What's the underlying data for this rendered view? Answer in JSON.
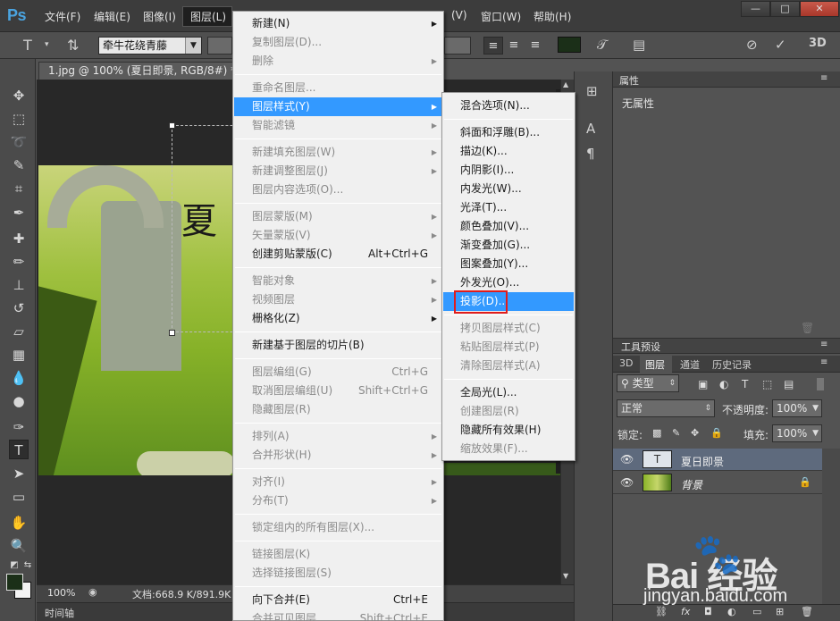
{
  "app": {
    "logo": "Ps",
    "menus": [
      "文件(F)",
      "编辑(E)",
      "图像(I)",
      "图层(L)",
      "(V)",
      "窗口(W)",
      "帮助(H)"
    ],
    "window_buttons": [
      "—",
      "□",
      "✕"
    ]
  },
  "options_bar": {
    "font_family": "牵牛花绕青藤",
    "align_buttons": [
      "≡",
      "≡",
      "≡"
    ],
    "text_color": "#1b2f18"
  },
  "document": {
    "tab_title": "1.jpg @ 100% (夏日即景, RGB/8#) *",
    "tab_close": "×",
    "canvas_text": "夏",
    "zoom": "100%",
    "doc_info": "文档:668.9 K/891.9K",
    "timeline_label": "时间轴"
  },
  "properties_panel": {
    "title": "属性",
    "content": "无属性"
  },
  "presets_panel": {
    "title": "工具预设"
  },
  "layers_panel": {
    "tabs": [
      "3D",
      "图层",
      "通道",
      "历史记录"
    ],
    "filter_kind": "类型",
    "blend_mode": "正常",
    "opacity_label": "不透明度:",
    "opacity_value": "100%",
    "lock_label": "锁定:",
    "fill_label": "填充:",
    "fill_value": "100%",
    "layers": [
      {
        "name": "夏日即景",
        "type": "text",
        "selected": true
      },
      {
        "name": "背景",
        "type": "image",
        "locked": true
      }
    ]
  },
  "layer_menu": {
    "items": [
      {
        "label": "新建(N)",
        "enabled": true,
        "submenu": true
      },
      {
        "label": "复制图层(D)...",
        "enabled": false
      },
      {
        "label": "删除",
        "enabled": false,
        "submenu": true
      },
      {
        "label": "重命名图层...",
        "enabled": false
      },
      {
        "label": "图层样式(Y)",
        "enabled": true,
        "submenu": true,
        "highlighted": true
      },
      {
        "label": "智能滤镜",
        "enabled": false,
        "submenu": true
      },
      {
        "label": "新建填充图层(W)",
        "enabled": false,
        "submenu": true
      },
      {
        "label": "新建调整图层(J)",
        "enabled": false,
        "submenu": true
      },
      {
        "label": "图层内容选项(O)...",
        "enabled": false
      },
      {
        "label": "图层蒙版(M)",
        "enabled": false,
        "submenu": true
      },
      {
        "label": "矢量蒙版(V)",
        "enabled": false,
        "submenu": true
      },
      {
        "label": "创建剪贴蒙版(C)",
        "enabled": true,
        "shortcut": "Alt+Ctrl+G"
      },
      {
        "label": "智能对象",
        "enabled": false,
        "submenu": true
      },
      {
        "label": "视频图层",
        "enabled": false,
        "submenu": true
      },
      {
        "label": "栅格化(Z)",
        "enabled": true,
        "submenu": true
      },
      {
        "label": "新建基于图层的切片(B)",
        "enabled": true
      },
      {
        "label": "图层编组(G)",
        "enabled": false,
        "shortcut": "Ctrl+G"
      },
      {
        "label": "取消图层编组(U)",
        "enabled": false,
        "shortcut": "Shift+Ctrl+G"
      },
      {
        "label": "隐藏图层(R)",
        "enabled": false
      },
      {
        "label": "排列(A)",
        "enabled": false,
        "submenu": true
      },
      {
        "label": "合并形状(H)",
        "enabled": false,
        "submenu": true
      },
      {
        "label": "对齐(I)",
        "enabled": false,
        "submenu": true
      },
      {
        "label": "分布(T)",
        "enabled": false,
        "submenu": true
      },
      {
        "label": "锁定组内的所有图层(X)...",
        "enabled": false
      },
      {
        "label": "链接图层(K)",
        "enabled": false
      },
      {
        "label": "选择链接图层(S)",
        "enabled": false
      },
      {
        "label": "向下合并(E)",
        "enabled": true,
        "shortcut": "Ctrl+E"
      },
      {
        "label": "合并可见图层",
        "enabled": false,
        "shortcut": "Shift+Ctrl+E"
      }
    ]
  },
  "layer_style_menu": {
    "items": [
      {
        "label": "混合选项(N)...",
        "enabled": true
      },
      {
        "label": "斜面和浮雕(B)...",
        "enabled": true
      },
      {
        "label": "描边(K)...",
        "enabled": true
      },
      {
        "label": "内阴影(I)...",
        "enabled": true
      },
      {
        "label": "内发光(W)...",
        "enabled": true
      },
      {
        "label": "光泽(T)...",
        "enabled": true
      },
      {
        "label": "颜色叠加(V)...",
        "enabled": true
      },
      {
        "label": "渐变叠加(G)...",
        "enabled": true
      },
      {
        "label": "图案叠加(Y)...",
        "enabled": true
      },
      {
        "label": "外发光(O)...",
        "enabled": true
      },
      {
        "label": "投影(D)...",
        "enabled": true,
        "highlighted": true
      },
      {
        "label": "拷贝图层样式(C)",
        "enabled": false
      },
      {
        "label": "粘贴图层样式(P)",
        "enabled": false
      },
      {
        "label": "清除图层样式(A)",
        "enabled": false
      },
      {
        "label": "全局光(L)...",
        "enabled": true
      },
      {
        "label": "创建图层(R)",
        "enabled": false
      },
      {
        "label": "隐藏所有效果(H)",
        "enabled": true
      },
      {
        "label": "缩放效果(F)...",
        "enabled": false
      }
    ]
  },
  "watermark": {
    "logo_text": "Bai  经验",
    "url": "jingyan.baidu.com"
  },
  "colors": {
    "menu_highlight": "#3399ff",
    "annotation_box": "#e01c1c",
    "foreground": "#1b2f18",
    "background": "#f4f4f4"
  }
}
